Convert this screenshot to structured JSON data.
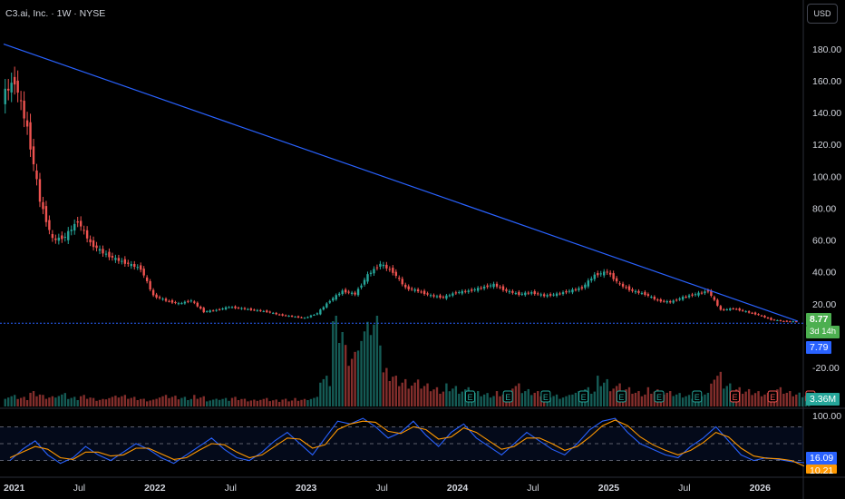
{
  "header": {
    "title": "C3.ai, Inc. · 1W · NYSE",
    "currency": "USD"
  },
  "price_tag": {
    "last": "8.77",
    "countdown": "3d 14h",
    "line_value": "7.79"
  },
  "volume_tag": "3.36M",
  "rsi_tag": {
    "main": "16.09",
    "secondary": "10.21"
  },
  "colors": {
    "up": "#26a69a",
    "down": "#ef5350",
    "trend": "#2962ff",
    "rsi_k": "#2962ff",
    "rsi_d": "#ff9800",
    "last_bg": "#4caf50"
  },
  "chart_data": [
    {
      "type": "line",
      "title": "",
      "yaxis_ticks": [
        "180.00",
        "160.00",
        "140.00",
        "120.00",
        "100.00",
        "80.00",
        "60.00",
        "40.00",
        "20.00",
        "-20.00"
      ],
      "xaxis_ticks": [
        "2021",
        "Jul",
        "2022",
        "Jul",
        "2023",
        "Jul",
        "2024",
        "Jul",
        "2025",
        "Jul",
        "2026"
      ],
      "ylim": [
        -20,
        185
      ],
      "series": [
        {
          "x": [
            "2020-12",
            "2021-01",
            "2021-02",
            "2021-03",
            "2021-04",
            "2021-05",
            "2021-06",
            "2021-07",
            "2021-08",
            "2021-09",
            "2021-10",
            "2021-11",
            "2021-12",
            "2022-01",
            "2022-02",
            "2022-03",
            "2022-04",
            "2022-05",
            "2022-06",
            "2022-07",
            "2022-08",
            "2022-09",
            "2022-10",
            "2022-11",
            "2022-12",
            "2023-01",
            "2023-02",
            "2023-03",
            "2023-04",
            "2023-05",
            "2023-06",
            "2023-07",
            "2023-08",
            "2023-09",
            "2023-10",
            "2023-11",
            "2023-12",
            "2024-01",
            "2024-02",
            "2024-03",
            "2024-04",
            "2024-05",
            "2024-06",
            "2024-07",
            "2024-08",
            "2024-09",
            "2024-10",
            "2024-11",
            "2024-12",
            "2025-01",
            "2025-02",
            "2025-03",
            "2025-04",
            "2025-05",
            "2025-06",
            "2025-07",
            "2025-08",
            "2025-09",
            "2025-10",
            "2025-11",
            "2025-12",
            "2026-01",
            "2026-02",
            "2026-03"
          ],
          "values": [
            150,
            160,
            130,
            85,
            60,
            62,
            72,
            58,
            52,
            48,
            45,
            42,
            25,
            22,
            20,
            22,
            15,
            16,
            18,
            17,
            16,
            15,
            13,
            12,
            11,
            14,
            22,
            28,
            26,
            38,
            45,
            40,
            30,
            28,
            25,
            24,
            27,
            28,
            30,
            32,
            28,
            26,
            27,
            25,
            26,
            28,
            30,
            38,
            40,
            32,
            28,
            26,
            22,
            21,
            24,
            26,
            28,
            16,
            17,
            15,
            13,
            10,
            9,
            8.77
          ]
        }
      ],
      "trendline": {
        "from": [
          "2020-12",
          183
        ],
        "to": [
          "2026-03",
          9
        ]
      },
      "horizontal_level": 7.79
    },
    {
      "type": "bar",
      "name": "Volume",
      "note_marks": "E",
      "values": [
        0.3,
        0.25,
        0.4,
        0.3,
        0.35,
        0.25,
        0.3,
        0.22,
        0.28,
        0.3,
        0.25,
        0.2,
        0.3,
        0.28,
        0.25,
        0.3,
        0.2,
        0.22,
        0.25,
        0.2,
        0.22,
        0.18,
        0.2,
        0.22,
        0.25,
        0.8,
        2.5,
        1.6,
        2.2,
        2.4,
        1.0,
        0.8,
        0.7,
        0.6,
        0.5,
        0.6,
        0.5,
        0.4,
        0.35,
        0.4,
        0.6,
        0.45,
        0.4,
        0.35,
        0.3,
        0.4,
        0.5,
        0.8,
        0.6,
        0.5,
        0.4,
        0.5,
        0.4,
        0.35,
        0.3,
        0.4,
        0.9,
        0.6,
        0.5,
        0.45,
        0.4,
        0.5,
        0.4,
        0.36
      ],
      "earnings": [
        37,
        40,
        43,
        46,
        49,
        52,
        55,
        58,
        61,
        64
      ]
    },
    {
      "type": "line",
      "name": "Stoch RSI",
      "yaxis_ticks": [
        "100.00"
      ],
      "bands": [
        80,
        50,
        20
      ],
      "k": [
        20,
        40,
        55,
        30,
        15,
        25,
        45,
        30,
        20,
        35,
        50,
        40,
        25,
        15,
        30,
        45,
        60,
        40,
        25,
        20,
        35,
        55,
        70,
        50,
        30,
        60,
        90,
        85,
        95,
        80,
        60,
        70,
        90,
        65,
        45,
        70,
        85,
        60,
        45,
        30,
        50,
        70,
        55,
        40,
        30,
        50,
        75,
        90,
        95,
        70,
        50,
        40,
        30,
        25,
        45,
        60,
        80,
        55,
        30,
        20,
        25,
        22,
        18,
        16.09
      ],
      "d": [
        25,
        35,
        45,
        40,
        25,
        22,
        35,
        35,
        28,
        30,
        42,
        42,
        32,
        22,
        25,
        38,
        50,
        48,
        35,
        25,
        30,
        45,
        60,
        58,
        42,
        48,
        75,
        85,
        90,
        88,
        72,
        68,
        80,
        75,
        58,
        62,
        78,
        70,
        55,
        40,
        45,
        60,
        60,
        50,
        38,
        45,
        62,
        82,
        92,
        82,
        62,
        48,
        38,
        30,
        38,
        52,
        70,
        62,
        42,
        28,
        24,
        23,
        20,
        10.21
      ]
    }
  ]
}
